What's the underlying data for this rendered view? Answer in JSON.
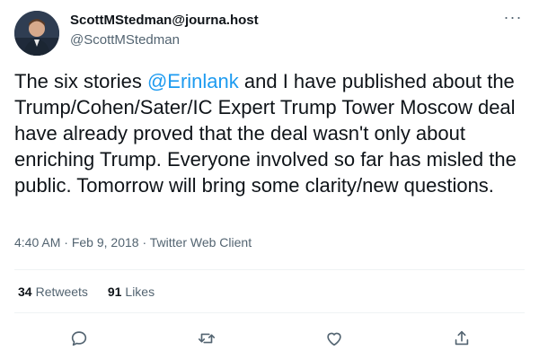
{
  "author": {
    "display_name": "ScottMStedman@journa.host",
    "handle": "@ScottMStedman"
  },
  "tweet": {
    "text_before": "The six stories ",
    "mention": "@Erinlank",
    "text_after": " and I have published about the Trump/Cohen/Sater/IC Expert Trump Tower Moscow deal have already proved that the deal wasn't only about enriching Trump. Everyone involved so far has misled the public. Tomorrow will bring some clarity/new questions."
  },
  "meta": {
    "time": "4:40 AM",
    "date": "Feb 9, 2018",
    "client": "Twitter Web Client",
    "separator": " · "
  },
  "stats": {
    "retweets_count": "34",
    "retweets_label": "Retweets",
    "likes_count": "91",
    "likes_label": "Likes"
  },
  "menu": {
    "more_label": "···"
  },
  "actions": [
    "reply-icon",
    "retweet-icon",
    "like-icon",
    "share-icon"
  ],
  "colors": {
    "accent": "#1d9bf0",
    "secondary_text": "#536471",
    "primary_text": "#0f1419"
  }
}
